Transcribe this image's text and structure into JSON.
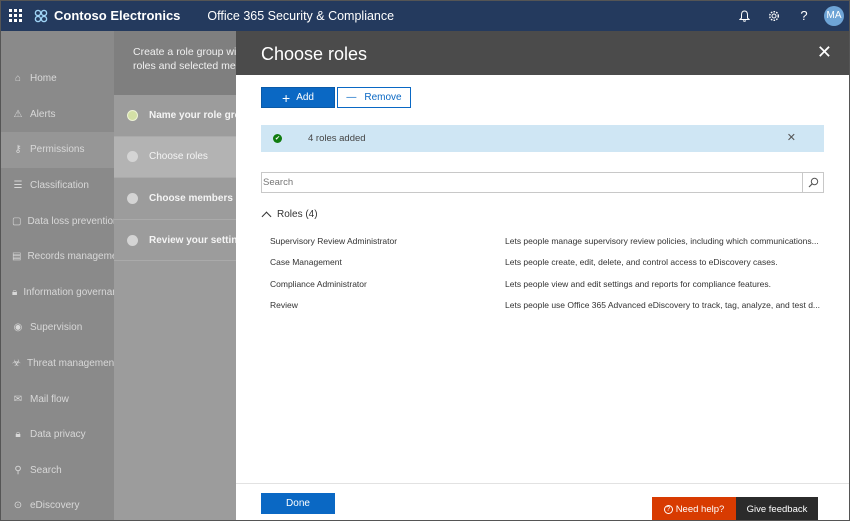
{
  "header": {
    "brand": "Contoso Electronics",
    "app_title": "Office 365 Security & Compliance",
    "avatar_initials": "MA",
    "bar_color": "#243a5e",
    "icons": [
      "waffle-icon",
      "bell-icon",
      "gear-icon",
      "help-icon"
    ]
  },
  "sidebar": {
    "items": [
      {
        "label": "Home",
        "icon": "home-icon"
      },
      {
        "label": "Alerts",
        "icon": "alert-icon"
      },
      {
        "label": "Permissions",
        "icon": "permissions-icon"
      },
      {
        "label": "Classification",
        "icon": "classification-icon"
      },
      {
        "label": "Data loss prevention",
        "icon": "dlp-icon"
      },
      {
        "label": "Records management",
        "icon": "records-icon"
      },
      {
        "label": "Information governance",
        "icon": "lock-icon"
      },
      {
        "label": "Supervision",
        "icon": "eye-icon"
      },
      {
        "label": "Threat management",
        "icon": "biohazard-icon"
      },
      {
        "label": "Mail flow",
        "icon": "mail-icon"
      },
      {
        "label": "Data privacy",
        "icon": "lock-icon"
      },
      {
        "label": "Search",
        "icon": "search-icon"
      },
      {
        "label": "eDiscovery",
        "icon": "ediscovery-icon"
      }
    ],
    "active_index": 2
  },
  "wizard": {
    "intro": "Create a role group with roles and selected members",
    "intro_line1": "Create a role group wit",
    "intro_line2": "roles and selected mem",
    "steps": [
      {
        "label": "Name your role group",
        "state": "done"
      },
      {
        "label": "Choose roles",
        "state": "current"
      },
      {
        "label": "Choose members",
        "state": "pending"
      },
      {
        "label": "Review your settings",
        "state": "pending"
      }
    ]
  },
  "panel": {
    "title": "Choose roles",
    "add_label": "Add",
    "remove_label": "Remove",
    "notice_text": "4 roles added",
    "search_placeholder": "Search",
    "roles_heading": "Roles (4)",
    "roles": [
      {
        "name": "Supervisory Review Administrator",
        "description": "Lets people manage supervisory review policies, including which communications..."
      },
      {
        "name": "Case Management",
        "description": "Lets people create, edit, delete, and control access to eDiscovery cases."
      },
      {
        "name": "Compliance Administrator",
        "description": "Lets people view and edit settings and reports for compliance features."
      },
      {
        "name": "Review",
        "description": "Lets people use Office 365 Advanced eDiscovery to track, tag, analyze, and test d..."
      }
    ],
    "done_label": "Done",
    "help_label": "Need help?",
    "feedback_label": "Give feedback"
  },
  "colors": {
    "accent": "#0a68c4",
    "success": "#107c10",
    "help": "#d83b01"
  }
}
